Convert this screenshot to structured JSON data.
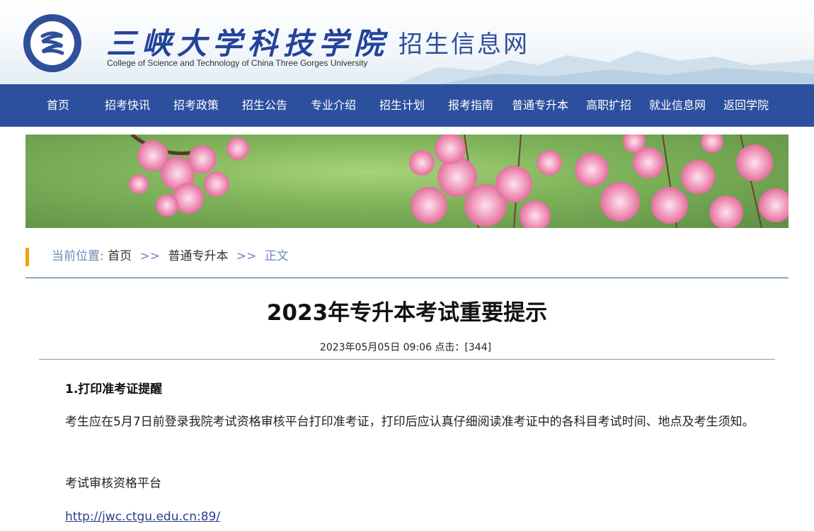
{
  "header": {
    "school_name_cn": "三峡大学科技学院",
    "site_name": "招生信息网",
    "school_name_en": "College of Science and Technology of China Three Gorges University"
  },
  "nav": {
    "items": [
      "首页",
      "招考快讯",
      "招考政策",
      "招生公告",
      "专业介绍",
      "招生计划",
      "报考指南",
      "普通专升本",
      "高职扩招",
      "就业信息网",
      "返回学院"
    ]
  },
  "breadcrumb": {
    "label": "当前位置:",
    "home": "首页",
    "sep1": ">>",
    "section": "普通专升本",
    "sep2": ">>",
    "current": "正文"
  },
  "article": {
    "title": "2023年专升本考试重要提示",
    "meta": "2023年05月05日 09:06 点击：[344]",
    "section1_heading": "1.打印准考证提醒",
    "paragraph1": "考生应在5月7日前登录我院考试资格审核平台打印准考证，打印后应认真仔细阅读准考证中的各科目考试时间、地点及考生须知。",
    "platform_label": "考试审核资格平台",
    "platform_link": "http://jwc.ctgu.edu.cn:89/"
  },
  "colors": {
    "nav_bg": "#2c4f9e",
    "brand_blue": "#23439a",
    "accent": "#f0a500"
  }
}
